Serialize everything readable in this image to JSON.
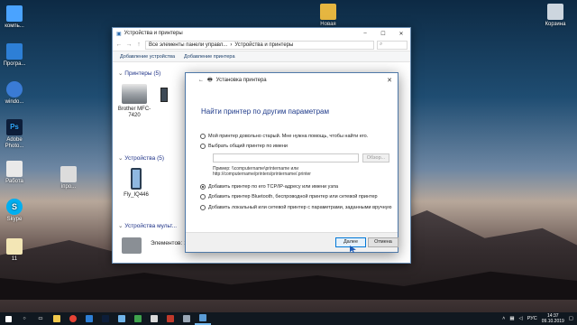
{
  "desktop": {
    "icons": [
      {
        "label": "компь...",
        "icon": "computer-icon",
        "color": "#4aa3ff"
      },
      {
        "label": "Програ...",
        "icon": "program-icon",
        "color": "#2d7fd6"
      },
      {
        "label": "windo...",
        "icon": "windows-icon",
        "color": "#3a7bd5"
      },
      {
        "label": "Adobe Photo...",
        "icon": "photoshop-icon",
        "color": "#0d1e3a"
      },
      {
        "label": "Работа",
        "icon": "monitor-icon",
        "color": "#e9e9e9"
      },
      {
        "label": "Skype",
        "icon": "skype-icon",
        "color": "#00aff0"
      },
      {
        "label": "11",
        "icon": "document-icon",
        "color": "#f3e6b5"
      },
      {
        "label": "Новая",
        "icon": "folder-icon",
        "color": "#e6b640"
      },
      {
        "label": "Корзина",
        "icon": "recycle-bin-icon",
        "color": "#cdd6df"
      },
      {
        "label": "іпро...",
        "icon": "shortcut-icon",
        "color": "#dcdcdc"
      }
    ]
  },
  "explorer": {
    "title": "Устройства и принтеры",
    "breadcrumb": [
      "Все элементы панели управл...",
      "Устройства и принтеры"
    ],
    "search_placeholder": "Поиск",
    "commands": [
      "Добавление устройства",
      "Добавление принтера"
    ],
    "groups": {
      "printers": "Принтеры (5)",
      "devices": "Устройства (5)",
      "multimedia": "Устройства мульт..."
    },
    "printer_items": [
      {
        "name": "Brother MFC-7420"
      }
    ],
    "device_items": [
      {
        "name": "Fly_IQ446"
      }
    ],
    "elements_label": "Элементов: 11"
  },
  "dialog": {
    "title": "Установка принтера",
    "heading": "Найти принтер по другим параметрам",
    "options": [
      {
        "label": "Мой принтер довольно старый. Мне нужна помощь, чтобы найти его.",
        "selected": false
      },
      {
        "label": "Выбрать общий принтер по имени",
        "selected": false
      },
      {
        "label": "Добавить принтер по его TCP/IP-адресу или имени узла",
        "selected": true
      },
      {
        "label": "Добавить принтер Bluetooth, беспроводной принтер или сетевой принтер",
        "selected": false
      },
      {
        "label": "Добавить локальный или сетевой принтер с параметрами, заданными вручную",
        "selected": false
      }
    ],
    "browse_label": "Обзор...",
    "example_line1": "Пример: \\\\computername\\printername или",
    "example_line2": "http://computername/printers/printername/.printer",
    "next_label": "Далее",
    "cancel_label": "Отмена"
  },
  "taskbar": {
    "language": "РУС",
    "time": "14:37",
    "date": "09.10.2019"
  }
}
